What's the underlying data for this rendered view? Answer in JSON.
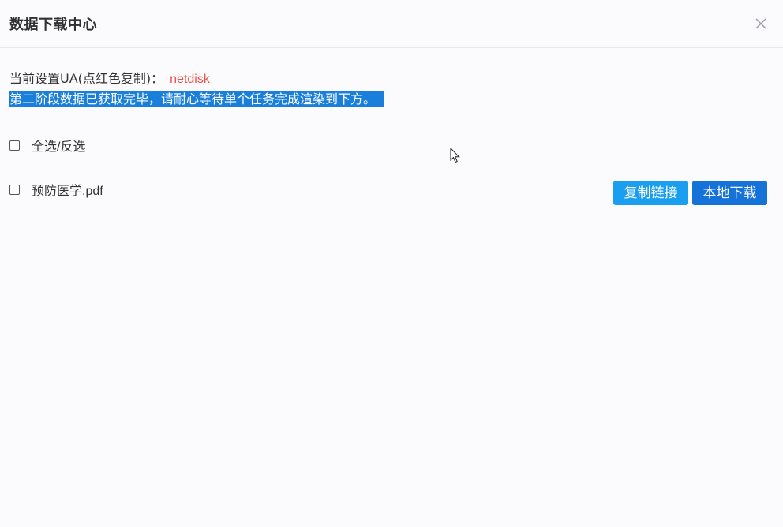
{
  "dialog": {
    "title": "数据下载中心",
    "close_icon": "close-icon"
  },
  "ua": {
    "label": "当前设置UA(点红色复制)：",
    "value": "netdisk",
    "value_color": "#f0504a"
  },
  "status": {
    "text": "第二阶段数据已获取完毕，请耐心等待单个任务完成渲染到下方。",
    "highlight_color": "#1a7fdb"
  },
  "select_all": {
    "label": "全选/反选",
    "checked": false
  },
  "files": [
    {
      "name": "预防医学.pdf",
      "checked": false,
      "copy_label": "复制链接",
      "download_label": "本地下载"
    }
  ],
  "colors": {
    "copy_button": "#1a9ff0",
    "download_button": "#1572d9"
  }
}
